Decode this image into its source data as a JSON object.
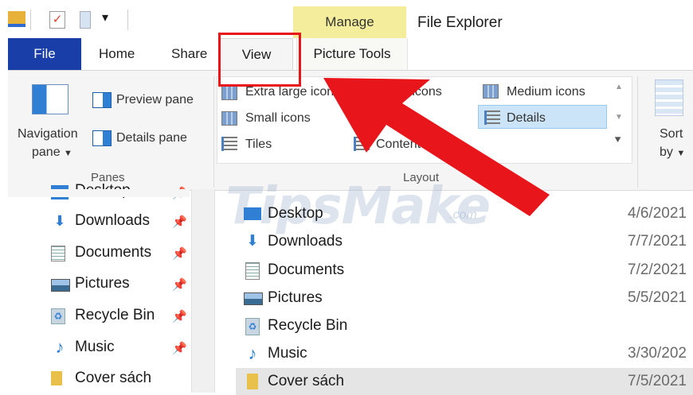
{
  "window": {
    "title": "File Explorer",
    "context_tab": "Manage"
  },
  "ribbon_tabs": {
    "file": "File",
    "home": "Home",
    "share": "Share",
    "view": "View",
    "picture_tools": "Picture Tools"
  },
  "panes": {
    "navigation_pane_line1": "Navigation",
    "navigation_pane_line2": "pane",
    "preview_pane": "Preview pane",
    "details_pane": "Details pane",
    "group_label": "Panes"
  },
  "layout": {
    "extra_large_icons": "Extra large icons",
    "large_icons": "Large icons",
    "medium_icons": "Medium icons",
    "small_icons": "Small icons",
    "details": "Details",
    "tiles": "Tiles",
    "content": "Content",
    "group_label": "Layout",
    "selected": "Details"
  },
  "sort": {
    "line1": "Sort",
    "line2": "by"
  },
  "watermark": {
    "text": "TipsMake",
    "suffix": ".com"
  },
  "nav_items": [
    {
      "label": "Desktop",
      "icon": "desktop-icon"
    },
    {
      "label": "Downloads",
      "icon": "download-arrow-icon"
    },
    {
      "label": "Documents",
      "icon": "document-icon"
    },
    {
      "label": "Pictures",
      "icon": "pictures-icon"
    },
    {
      "label": "Recycle Bin",
      "icon": "recycle-bin-icon"
    },
    {
      "label": "Music",
      "icon": "music-note-icon"
    },
    {
      "label": "Cover sách",
      "icon": "folder-icon"
    }
  ],
  "files": [
    {
      "name": "Desktop",
      "date": "4/6/2021",
      "icon": "desktop-icon"
    },
    {
      "name": "Downloads",
      "date": "7/7/2021",
      "icon": "download-arrow-icon"
    },
    {
      "name": "Documents",
      "date": "7/2/2021",
      "icon": "document-icon"
    },
    {
      "name": "Pictures",
      "date": "5/5/2021",
      "icon": "pictures-icon"
    },
    {
      "name": "Recycle Bin",
      "date": "",
      "icon": "recycle-bin-icon"
    },
    {
      "name": "Music",
      "date": "3/30/202",
      "icon": "music-note-icon"
    },
    {
      "name": "Cover sách",
      "date": "7/5/2021",
      "icon": "folder-icon"
    }
  ],
  "colors": {
    "file_tab": "#1a3ea7",
    "manage_tab": "#f4ee9c",
    "highlight_box": "#e8151a",
    "arrow": "#e8151a",
    "selection": "#cce4f7"
  }
}
